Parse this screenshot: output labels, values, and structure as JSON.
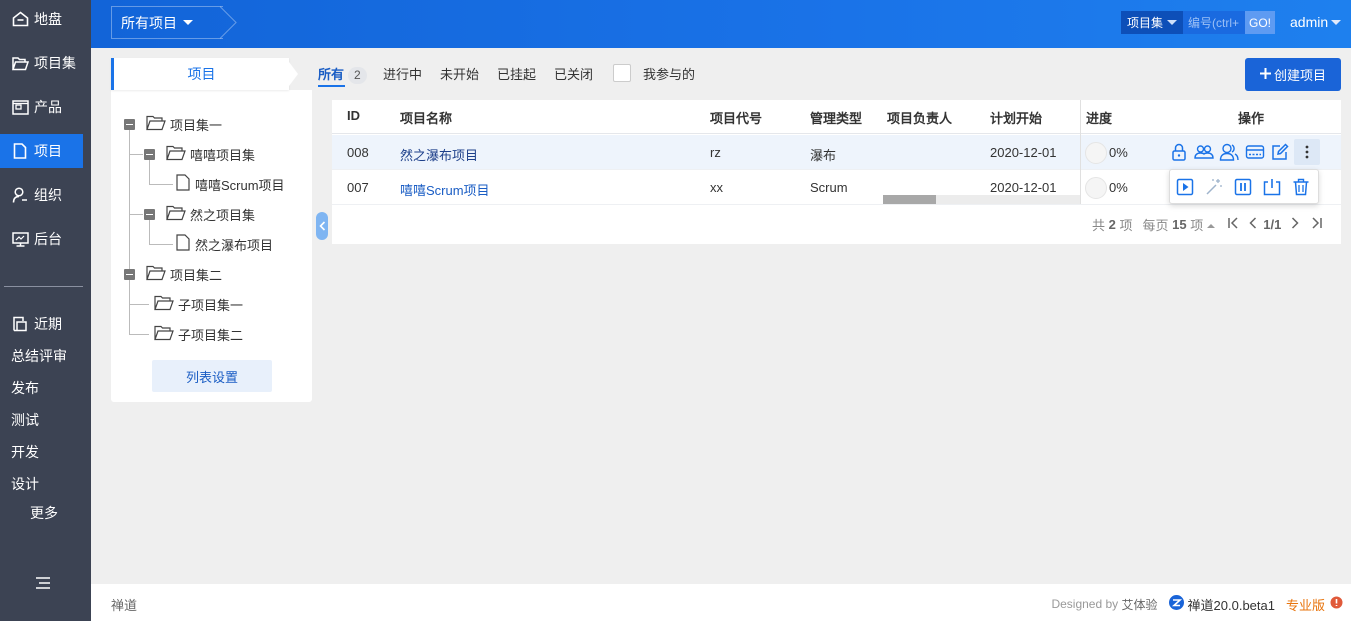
{
  "nav": {
    "items": [
      {
        "label": "地盘",
        "icon": "home-icon"
      },
      {
        "label": "项目集",
        "icon": "folder-open-icon"
      },
      {
        "label": "产品",
        "icon": "product-icon"
      },
      {
        "label": "项目",
        "icon": "file-icon"
      },
      {
        "label": "组织",
        "icon": "user-icon"
      },
      {
        "label": "后台",
        "icon": "monitor-icon"
      }
    ],
    "recent_label": "近期",
    "sub_items": [
      "总结评审",
      "发布",
      "测试",
      "开发",
      "设计"
    ],
    "more_label": "更多",
    "menu_icon": "menu-collapse-icon"
  },
  "header": {
    "crumb_label": "所有项目",
    "search": {
      "scope": "项目集",
      "placeholder": "编号(ctrl+",
      "go": "GO!"
    },
    "user": "admin"
  },
  "panel": {
    "tab_label": "项目",
    "tree": [
      "项目集一",
      "嘻嘻项目集",
      "嘻嘻Scrum项目",
      "然之项目集",
      "然之瀑布项目",
      "项目集二",
      "子项目集一",
      "子项目集二"
    ],
    "list_setting": "列表设置"
  },
  "filters": {
    "tabs": [
      {
        "label": "所有",
        "count": "2"
      },
      {
        "label": "进行中"
      },
      {
        "label": "未开始"
      },
      {
        "label": "已挂起"
      },
      {
        "label": "已关闭"
      }
    ],
    "mine_label": "我参与的",
    "create_label": "创建项目"
  },
  "table": {
    "headers": [
      "ID",
      "项目名称",
      "项目代号",
      "管理类型",
      "项目负责人",
      "计划开始",
      "进度",
      "操作"
    ],
    "rows": [
      {
        "id": "008",
        "name": "然之瀑布项目",
        "code": "rz",
        "type": "瀑布",
        "owner": "",
        "start": "2020-12-01",
        "progress": "0%"
      },
      {
        "id": "007",
        "name": "嘻嘻Scrum项目",
        "code": "xx",
        "type": "Scrum",
        "owner": "",
        "start": "2020-12-01",
        "progress": "0%"
      }
    ],
    "actions": [
      "lock-icon",
      "team-icon",
      "member-icon",
      "budget-icon",
      "edit-icon",
      "more-icon"
    ],
    "popup_actions": [
      "start-icon",
      "magic-icon",
      "suspend-icon",
      "close-project-icon",
      "delete-icon"
    ]
  },
  "pager": {
    "total_prefix": "共",
    "total": "2",
    "total_suffix": "项",
    "per_page_prefix": "每页",
    "per_page": "15",
    "per_page_suffix": "项",
    "page": "1/1"
  },
  "footer": {
    "left": "禅道",
    "designed_by": "Designed by",
    "designer": "艾体验",
    "version": "禅道20.0.beta1",
    "edition": "专业版"
  },
  "colors": {
    "accent": "#1a73e8",
    "nav_bg": "#3c4353",
    "edition": "#e8740c"
  }
}
